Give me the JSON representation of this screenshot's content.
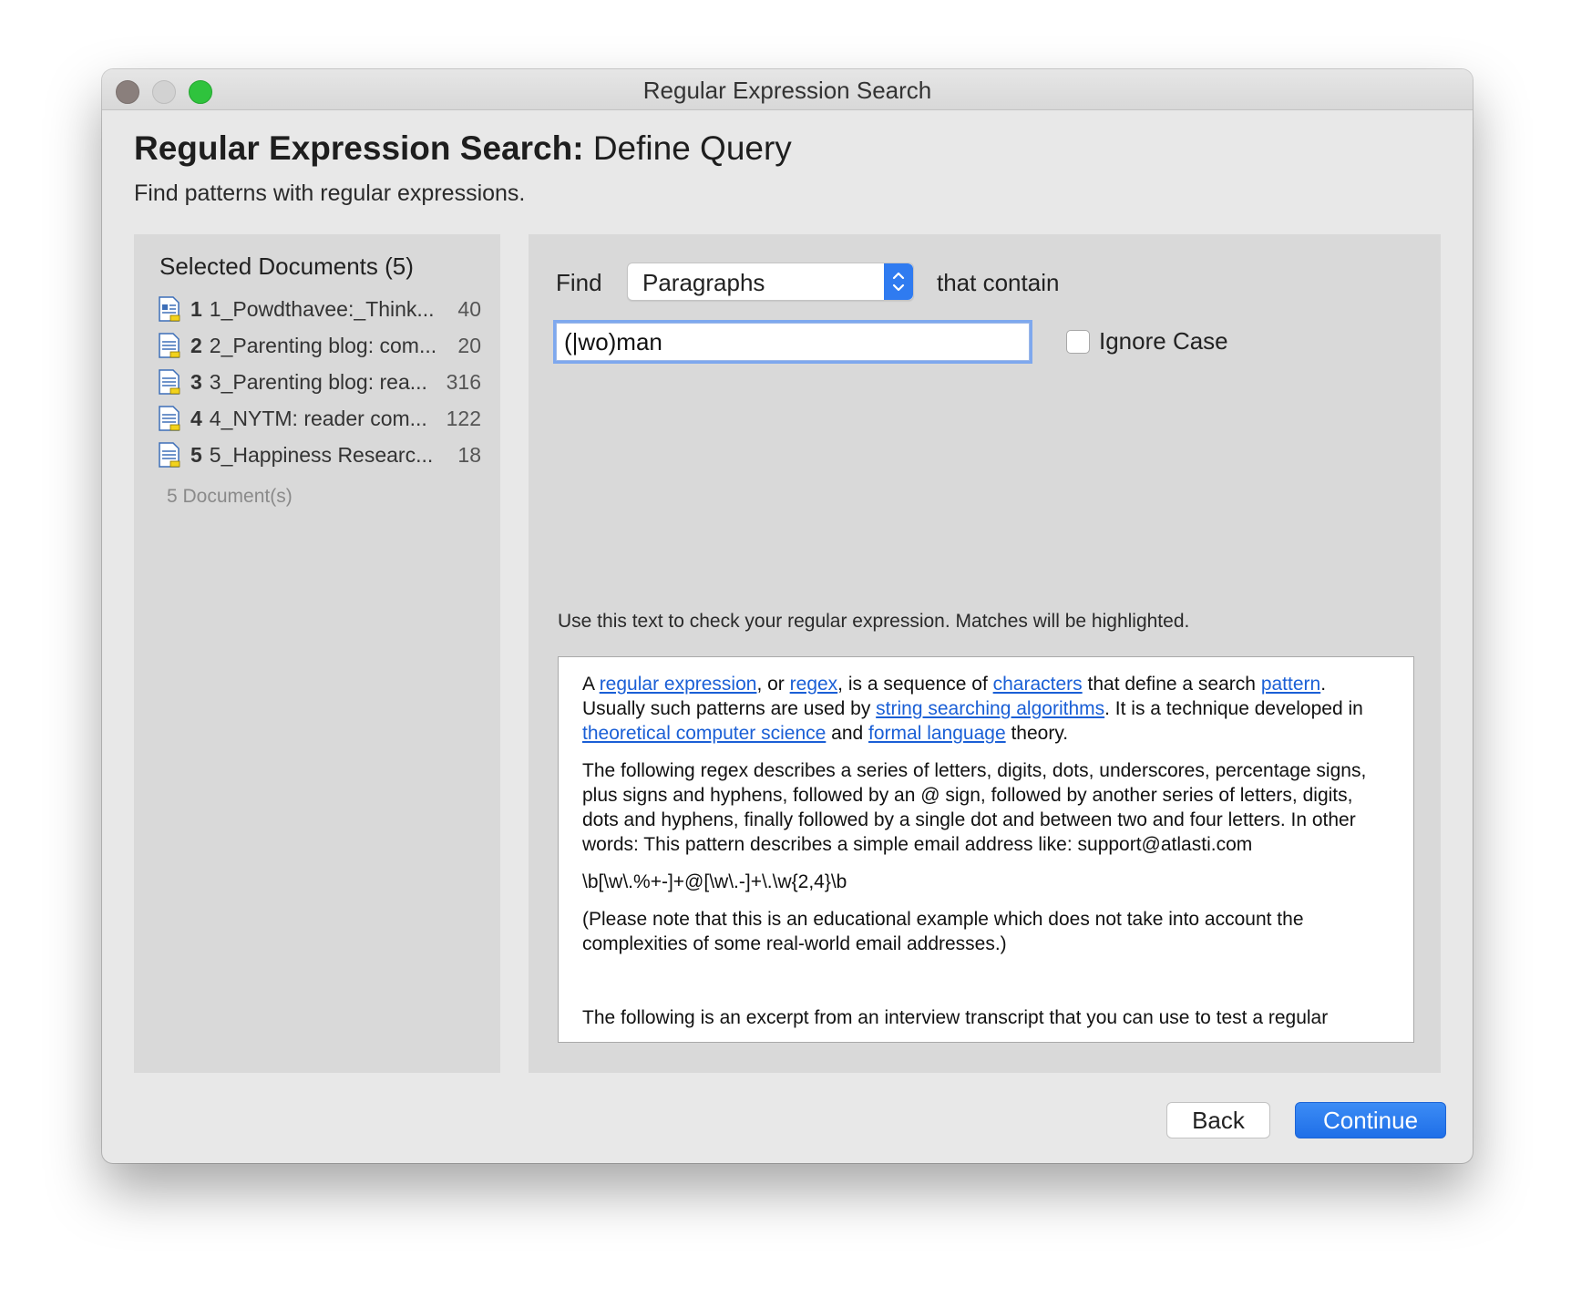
{
  "window": {
    "title": "Regular Expression Search"
  },
  "header": {
    "title_bold": "Regular Expression Search:",
    "title_rest": "Define Query",
    "subtitle": "Find patterns with regular expressions."
  },
  "documents": {
    "title": "Selected Documents (5)",
    "items": [
      {
        "num": "1",
        "name": "1_Powdthavee:_Think...",
        "count": "40",
        "icon": "text-document-image-icon"
      },
      {
        "num": "2",
        "name": "2_Parenting blog: com...",
        "count": "20",
        "icon": "text-document-icon"
      },
      {
        "num": "3",
        "name": "3_Parenting blog: rea...",
        "count": "316",
        "icon": "text-document-icon"
      },
      {
        "num": "4",
        "name": "4_NYTM: reader com...",
        "count": "122",
        "icon": "text-document-icon"
      },
      {
        "num": "5",
        "name": "5_Happiness Researc...",
        "count": "18",
        "icon": "text-document-icon"
      }
    ],
    "total": "5 Document(s)"
  },
  "query": {
    "find_label": "Find",
    "scope_value": "Paragraphs",
    "contain_label": "that contain",
    "regex_value": "(|wo)man",
    "ignore_case_label": "Ignore Case",
    "ignore_case_checked": false
  },
  "test": {
    "hint": "Use this text to check your regular expression. Matches will be highlighted.",
    "p1": {
      "a": "A ",
      "link1": "regular expression",
      "b": ", or ",
      "link2": "regex",
      "c": ", is a sequence of ",
      "link3": "characters",
      "d": " that define a search ",
      "link4": "pattern",
      "e": ". Usually such patterns are used by ",
      "link5": "string searching algorithms",
      "f": ". It is a technique developed in ",
      "link6": "theoretical computer science",
      "g": " and ",
      "link7": "formal language",
      "h": " theory."
    },
    "p2": "The following regex describes a series of letters, digits, dots, underscores, percentage signs, plus signs and hyphens, followed by an @ sign, followed by another series of letters, digits, dots and hyphens, finally followed by a single dot and between two and four letters. In other words: This pattern describes a simple email address like: support@atlasti.com",
    "p3": "\\b[\\w\\.%+-]+@[\\w\\.-]+\\.\\w{2,4}\\b",
    "p4": "(Please note that this is an educational example which does not take into account the complexities of some real-world email addresses.)",
    "p5": "The following is an excerpt from an interview transcript that you can use to test a regular"
  },
  "buttons": {
    "back": "Back",
    "continue": "Continue"
  },
  "colors": {
    "accent": "#2f7bf0",
    "link": "#1a5fd6"
  }
}
